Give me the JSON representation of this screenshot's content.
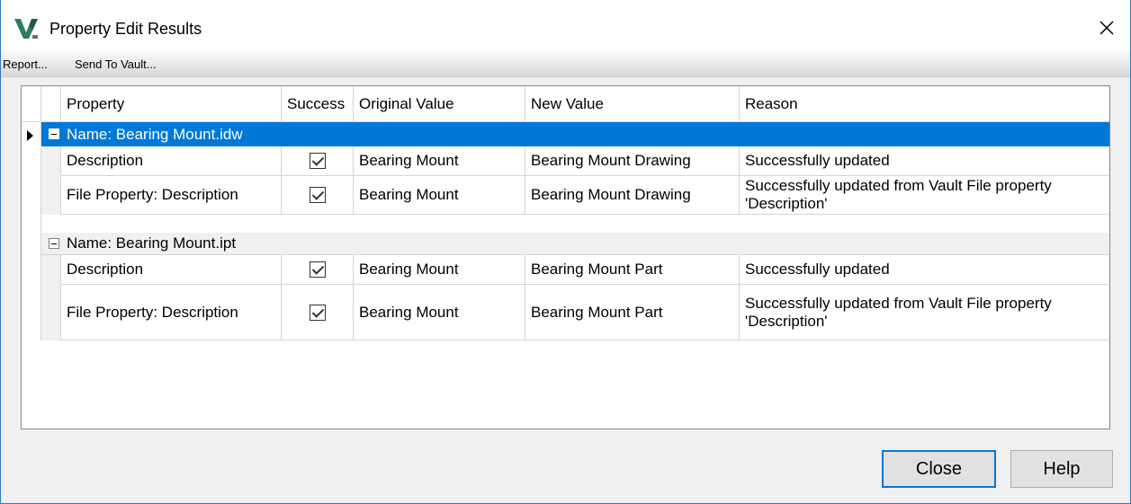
{
  "window": {
    "title": "Property Edit Results",
    "icon": "vault-logo-icon"
  },
  "menu": {
    "report": "Report...",
    "send_to_vault": "Send To Vault..."
  },
  "columns": [
    "Property",
    "Success",
    "Original Value",
    "New Value",
    "Reason"
  ],
  "groups": [
    {
      "label": "Name: Bearing Mount.idw",
      "selected": true,
      "rows": [
        {
          "property": "Description",
          "success": true,
          "original": "Bearing Mount",
          "new": "Bearing Mount Drawing",
          "reason": "Successfully updated"
        },
        {
          "property": "File Property: Description",
          "success": true,
          "original": "Bearing Mount",
          "new": "Bearing Mount Drawing",
          "reason": "Successfully updated from Vault File property 'Description'"
        }
      ]
    },
    {
      "label": "Name: Bearing Mount.ipt",
      "selected": false,
      "rows": [
        {
          "property": "Description",
          "success": true,
          "original": "Bearing Mount",
          "new": "Bearing Mount Part",
          "reason": "Successfully updated"
        },
        {
          "property": "File Property: Description",
          "success": true,
          "original": "Bearing Mount",
          "new": "Bearing Mount Part",
          "reason": "Successfully updated from Vault File property 'Description'"
        }
      ]
    }
  ],
  "buttons": {
    "close": "Close",
    "help": "Help"
  },
  "colors": {
    "selection": "#0078d7",
    "accent_border": "#2b79d0"
  }
}
